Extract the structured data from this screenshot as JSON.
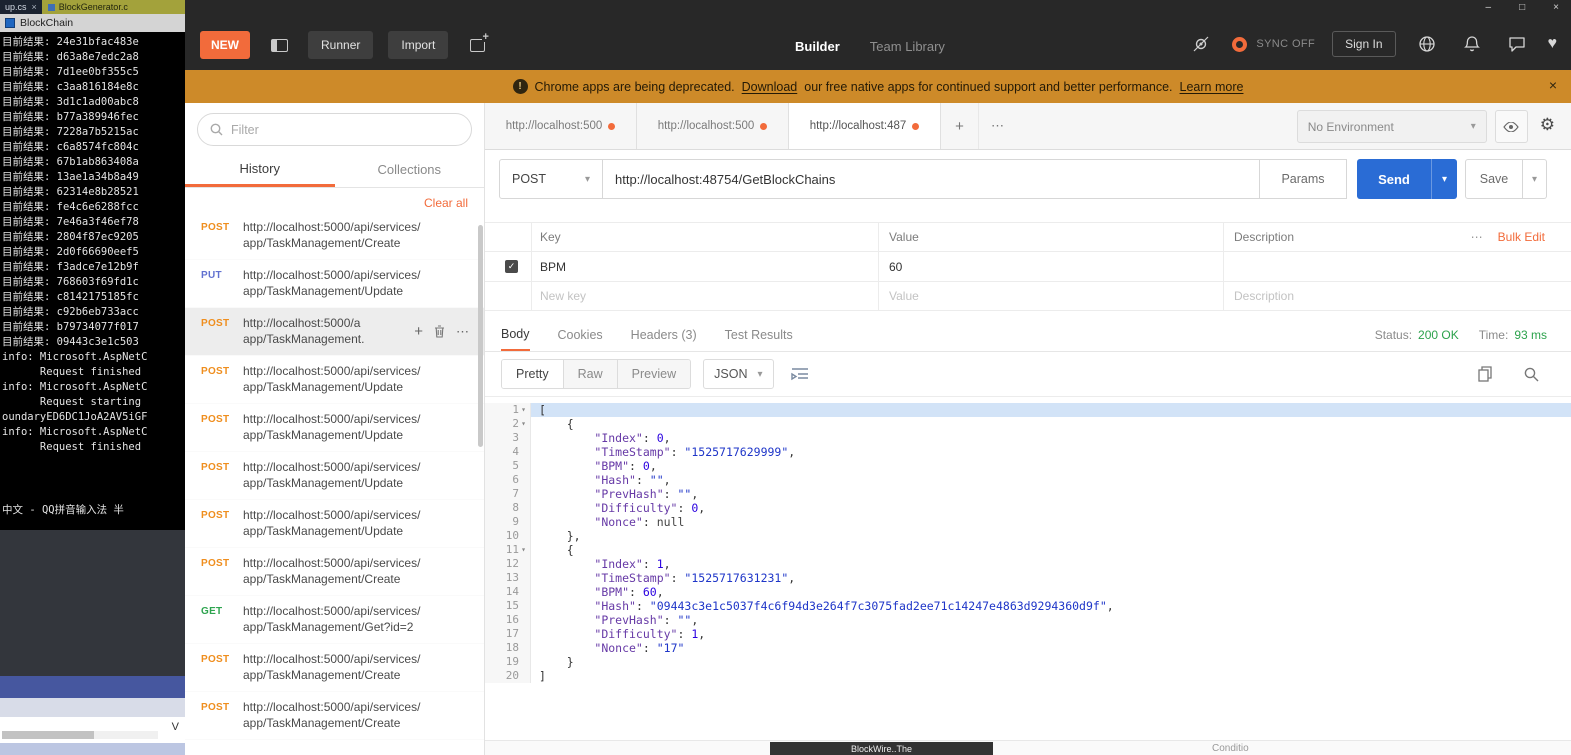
{
  "icons": {
    "minimize": "–",
    "maximize": "□",
    "close": "×",
    "caret_down": "▾",
    "ellipsis": "⋯",
    "plus": "+",
    "check": "✓",
    "heart": "♥",
    "gear": "⚙",
    "exclamation": "!"
  },
  "left_stack": {
    "editor_tabs": [
      {
        "label": "up.cs"
      },
      {
        "label": "BlockGenerator.c"
      }
    ],
    "console": {
      "title": "BlockChain",
      "result_prefix": "目前结果:",
      "hashes": [
        "24e31bfac483e",
        "d63a8e7edc2a8",
        "7d1ee0bf355c5",
        "c3aa816184e8c",
        "3d1c1ad00abc8",
        "b77a389946fec",
        "7228a7b5215ac",
        "c6a8574fc804c",
        "67b1ab863408a",
        "13ae1a34b8a49",
        "62314e8b28521",
        "fe4c6e6288fcc",
        "7e46a3f46ef78",
        "2804f87ec9205",
        "2d0f66690eef5",
        "f3adce7e12b9f",
        "768603f69fd1c",
        "c8142175185fc",
        "c92b6eb733acc",
        "b79734077f017",
        "09443c3e1c503"
      ],
      "log_lines": [
        "info: Microsoft.AspNetC",
        "      Request finished",
        "info: Microsoft.AspNetC",
        "      Request starting",
        "oundaryED6DC1JoA2AV5iGF",
        "info: Microsoft.AspNetC",
        "      Request finished"
      ],
      "ime_line": "中文 - QQ拼音输入法 半"
    },
    "bottom_label": "V"
  },
  "header": {
    "new_button": "NEW",
    "runner_button": "Runner",
    "import_button": "Import",
    "builder_tab": "Builder",
    "team_library_tab": "Team Library",
    "sync_label": "SYNC OFF",
    "sign_in_button": "Sign In"
  },
  "banner": {
    "prefix": "Chrome apps are being deprecated.",
    "download_link": "Download",
    "middle": "our free native apps for continued support and better performance.",
    "learn_more_link": "Learn more"
  },
  "sidebar": {
    "filter_placeholder": "Filter",
    "history_tab": "History",
    "collections_tab": "Collections",
    "clear_all": "Clear all",
    "items": [
      {
        "method": "POST",
        "line1": "http://localhost:5000/api/services/",
        "line2": "app/TaskManagement/Create"
      },
      {
        "method": "PUT",
        "line1": "http://localhost:5000/api/services/",
        "line2": "app/TaskManagement/Update"
      },
      {
        "method": "POST",
        "line1": "http://localhost:5000/a",
        "line2": "app/TaskManagement.",
        "hovered": true
      },
      {
        "method": "POST",
        "line1": "http://localhost:5000/api/services/",
        "line2": "app/TaskManagement/Update"
      },
      {
        "method": "POST",
        "line1": "http://localhost:5000/api/services/",
        "line2": "app/TaskManagement/Update"
      },
      {
        "method": "POST",
        "line1": "http://localhost:5000/api/services/",
        "line2": "app/TaskManagement/Update"
      },
      {
        "method": "POST",
        "line1": "http://localhost:5000/api/services/",
        "line2": "app/TaskManagement/Update"
      },
      {
        "method": "POST",
        "line1": "http://localhost:5000/api/services/",
        "line2": "app/TaskManagement/Create"
      },
      {
        "method": "GET",
        "line1": "http://localhost:5000/api/services/",
        "line2": "app/TaskManagement/Get?id=2"
      },
      {
        "method": "POST",
        "line1": "http://localhost:5000/api/services/",
        "line2": "app/TaskManagement/Create"
      },
      {
        "method": "POST",
        "line1": "http://localhost:5000/api/services/",
        "line2": "app/TaskManagement/Create"
      }
    ]
  },
  "request_tabs": {
    "tabs": [
      {
        "label": "http://localhost:500"
      },
      {
        "label": "http://localhost:500"
      },
      {
        "label": "http://localhost:487",
        "active": true
      }
    ],
    "environment": "No Environment"
  },
  "request": {
    "method": "POST",
    "url": "http://localhost:48754/GetBlockChains",
    "params_button": "Params",
    "send_button": "Send",
    "save_button": "Save"
  },
  "kv_table": {
    "headers": [
      "Key",
      "Value",
      "Description"
    ],
    "bulk_edit": "Bulk Edit",
    "row": {
      "key": "BPM",
      "value": "60",
      "description": ""
    },
    "new_row": {
      "key": "New key",
      "value": "Value",
      "description": "Description"
    }
  },
  "response": {
    "tabs": [
      "Body",
      "Cookies",
      "Headers (3)",
      "Test Results"
    ],
    "status_label": "Status:",
    "status_value": "200 OK",
    "time_label": "Time:",
    "time_value": "93 ms",
    "modes": [
      "Pretty",
      "Raw",
      "Preview"
    ],
    "language": "JSON",
    "active_line": 1,
    "fold_lines": [
      1,
      2,
      11
    ],
    "body_lines": [
      "[",
      "    {",
      "        \"Index\": 0,",
      "        \"TimeStamp\": \"1525717629999\",",
      "        \"BPM\": 0,",
      "        \"Hash\": \"\",",
      "        \"PrevHash\": \"\",",
      "        \"Difficulty\": 0,",
      "        \"Nonce\": null",
      "    },",
      "    {",
      "        \"Index\": 1,",
      "        \"TimeStamp\": \"1525717631231\",",
      "        \"BPM\": 60,",
      "        \"Hash\": \"09443c3e1c5037f4c6f94d3e264f7c3075fad2ee71c14247e4863d9294360d9f\",",
      "        \"PrevHash\": \"\",",
      "        \"Difficulty\": 1,",
      "        \"Nonce\": \"17\"",
      "    }",
      "]"
    ]
  },
  "overlay": {
    "dark_label": "BlockWire..The",
    "condition_label": "Conditio"
  }
}
